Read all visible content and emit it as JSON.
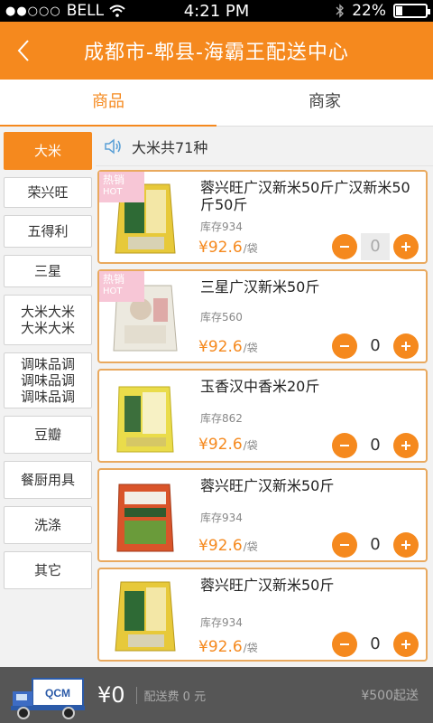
{
  "status_bar": {
    "carrier": "BELL",
    "signal_dots": "●●○○○",
    "time": "4:21 PM",
    "battery": "22%",
    "battery_level": 0.22
  },
  "nav": {
    "back_icon": "chevron-left-icon",
    "title": "成都市-郫县-海霸王配送中心"
  },
  "tabs": [
    {
      "label": "商品",
      "active": true
    },
    {
      "label": "商家",
      "active": false
    }
  ],
  "categories": [
    {
      "label": "大米",
      "active": true
    },
    {
      "label": "荣兴旺"
    },
    {
      "label": "五得利"
    },
    {
      "label": "三星"
    },
    {
      "label": "大米大米\n大米大米"
    },
    {
      "label": "调味品调\n调味品调\n调味品调"
    },
    {
      "label": "豆瓣"
    },
    {
      "label": "餐厨用具"
    },
    {
      "label": "洗涤"
    },
    {
      "label": "其它"
    }
  ],
  "content": {
    "speaker_icon": "speaker-icon",
    "count_text": "大米共71种"
  },
  "products": [
    {
      "hot": true,
      "hot_label": "热销",
      "hot_en": "HOT",
      "name": "蓉兴旺广汉新米50斤广汉新米50斤50斤",
      "stock": "库存934",
      "price": "¥92.6",
      "unit": "/袋",
      "qty": "0",
      "qty_boxed": true
    },
    {
      "hot": true,
      "hot_label": "热销",
      "hot_en": "HOT",
      "name": "三星广汉新米50斤",
      "stock": "库存560",
      "price": "¥92.6",
      "unit": "/袋",
      "qty": "0",
      "qty_boxed": false
    },
    {
      "hot": false,
      "name": "玉香汉中香米20斤",
      "stock": "库存862",
      "price": "¥92.6",
      "unit": "/袋",
      "qty": "0",
      "qty_boxed": false
    },
    {
      "hot": false,
      "name": "蓉兴旺广汉新米50斤",
      "stock": "库存934",
      "price": "¥92.6",
      "unit": "/袋",
      "qty": "0",
      "qty_boxed": false
    },
    {
      "hot": false,
      "name": "蓉兴旺广汉新米50斤",
      "stock": "库存934",
      "price": "¥92.6",
      "unit": "/袋",
      "qty": "0",
      "qty_boxed": false
    }
  ],
  "footer": {
    "logo_text": "QCM",
    "total": "¥0",
    "delivery_fee": "配送费 0 元",
    "min_order": "¥500起送"
  },
  "colors": {
    "accent": "#f5891e",
    "footer_bg": "#565656",
    "card_border": "#e9a95e"
  }
}
